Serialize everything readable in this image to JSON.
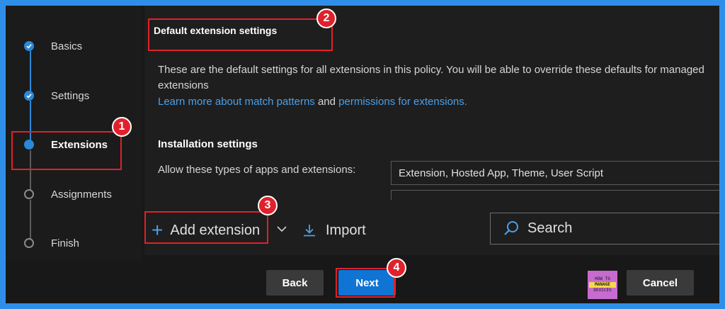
{
  "stepper": {
    "steps": [
      {
        "label": "Basics",
        "state": "done"
      },
      {
        "label": "Settings",
        "state": "done"
      },
      {
        "label": "Extensions",
        "state": "current"
      },
      {
        "label": "Assignments",
        "state": "pending"
      },
      {
        "label": "Finish",
        "state": "pending"
      }
    ]
  },
  "main": {
    "section_title": "Default extension settings",
    "description": "These are the default settings for all extensions in this policy. You will be able to override these defaults for managed extensions",
    "link_match_patterns": "Learn more about match patterns",
    "link_and": "and",
    "link_permissions": "permissions for extensions.",
    "install_title": "Installation settings",
    "allow_label": "Allow these types of apps and extensions:",
    "allow_value": "Extension, Hosted App, Theme, User Script"
  },
  "toolbar": {
    "add_label": "Add extension",
    "import_label": "Import",
    "search_placeholder": "Search"
  },
  "footer": {
    "back_label": "Back",
    "next_label": "Next",
    "cancel_label": "Cancel",
    "watermark_top": "HOW TO",
    "watermark_mid": "MANAGE",
    "watermark_bot": "DEVICES"
  },
  "annotations": {
    "badge_1": "1",
    "badge_2": "2",
    "badge_3": "3",
    "badge_4": "4"
  },
  "colors": {
    "accent": "#2b88d8",
    "highlight": "#e0212b",
    "primary_button": "#0f74d3",
    "link": "#4ba0e8"
  }
}
